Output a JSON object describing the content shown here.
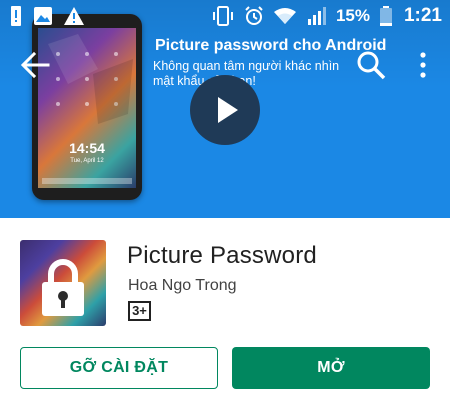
{
  "colors": {
    "hero_bg": "#1b88e5",
    "accent_green": "#01875f",
    "text_primary": "#212121",
    "text_secondary": "#424242"
  },
  "status_bar": {
    "left_icons": [
      "warning-icon",
      "image-icon",
      "alert-icon"
    ],
    "right_icons": [
      "vibrate-icon",
      "alarm-icon",
      "wifi-icon",
      "signal-icon",
      "battery-icon"
    ],
    "battery_percent": "15%",
    "time": "1:21"
  },
  "app_bar": {
    "icons": [
      "back-arrow-icon",
      "search-icon",
      "more-vert-icon"
    ]
  },
  "hero": {
    "title": "Picture password cho Android",
    "subtitle": "Không quan tâm người khác nhìn mật khẩu của bạn!",
    "phone_time": "14:54",
    "phone_date": "Tue, April 12"
  },
  "app": {
    "name": "Picture Password",
    "developer": "Hoa Ngo Trong",
    "content_rating": "3+"
  },
  "actions": {
    "uninstall_label": "GỠ CÀI ĐẶT",
    "open_label": "MỞ"
  }
}
